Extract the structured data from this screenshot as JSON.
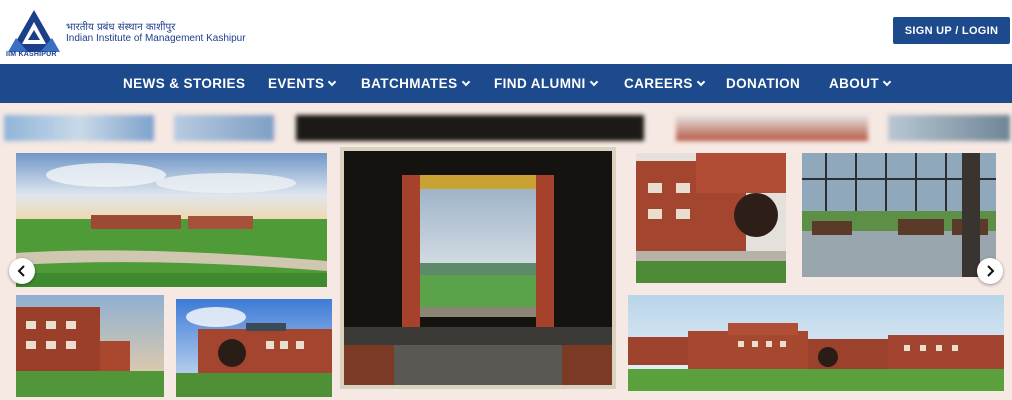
{
  "header": {
    "logo_caption": "IIM KASHIPUR",
    "brand_hindi": "भारतीय प्रबंध संस्थान काशीपुर",
    "brand_english": "Indian Institute of Management Kashipur",
    "signup_label": "SIGN UP / LOGIN"
  },
  "nav": {
    "items": [
      {
        "label": "NEWS & STORIES",
        "dropdown": false
      },
      {
        "label": "EVENTS",
        "dropdown": true
      },
      {
        "label": "BATCHMATES",
        "dropdown": true
      },
      {
        "label": "FIND ALUMNI",
        "dropdown": true
      },
      {
        "label": "CAREERS",
        "dropdown": true
      },
      {
        "label": "DONATION",
        "dropdown": false
      },
      {
        "label": "ABOUT",
        "dropdown": true
      }
    ]
  },
  "gallery": {
    "prev_icon": "chevron-left-icon",
    "next_icon": "chevron-right-icon"
  },
  "colors": {
    "brand_blue": "#1d4a8c",
    "gallery_bg": "#f6e8e2"
  }
}
